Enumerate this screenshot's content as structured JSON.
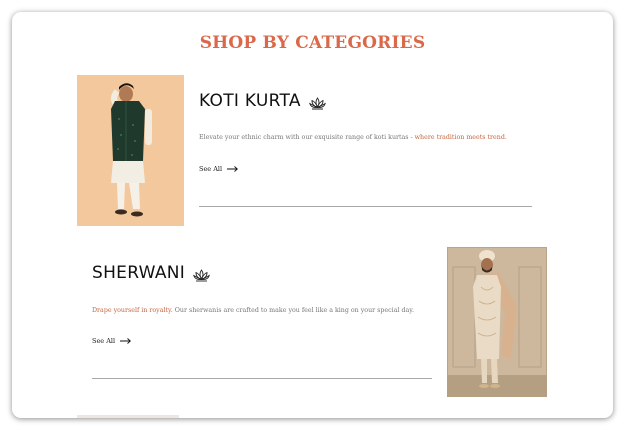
{
  "section": {
    "title": "SHOP BY CATEGORIES",
    "title_color": "#d9694a"
  },
  "categories": [
    {
      "name": "KOTI KURTA",
      "icon": "lotus-icon",
      "description_plain": "Elevate your ethnic charm with our exquisite range of koti kurtas - ",
      "description_highlight": "where tradition meets trend.",
      "see_all": "See All",
      "image_alt": "Man wearing green koti kurta over white kurta"
    },
    {
      "name": "SHERWANI",
      "icon": "lotus-icon",
      "description_highlight": "Drape yourself in royalty.",
      "description_plain": " Our sherwanis are crafted to make you feel like a king on your special day.",
      "see_all": "See All",
      "image_alt": "Man wearing ivory embroidered sherwani with stole and turban"
    }
  ],
  "colors": {
    "accent": "#c8653e",
    "text": "#111111",
    "muted": "#777777",
    "rule": "#a9a9a9"
  }
}
